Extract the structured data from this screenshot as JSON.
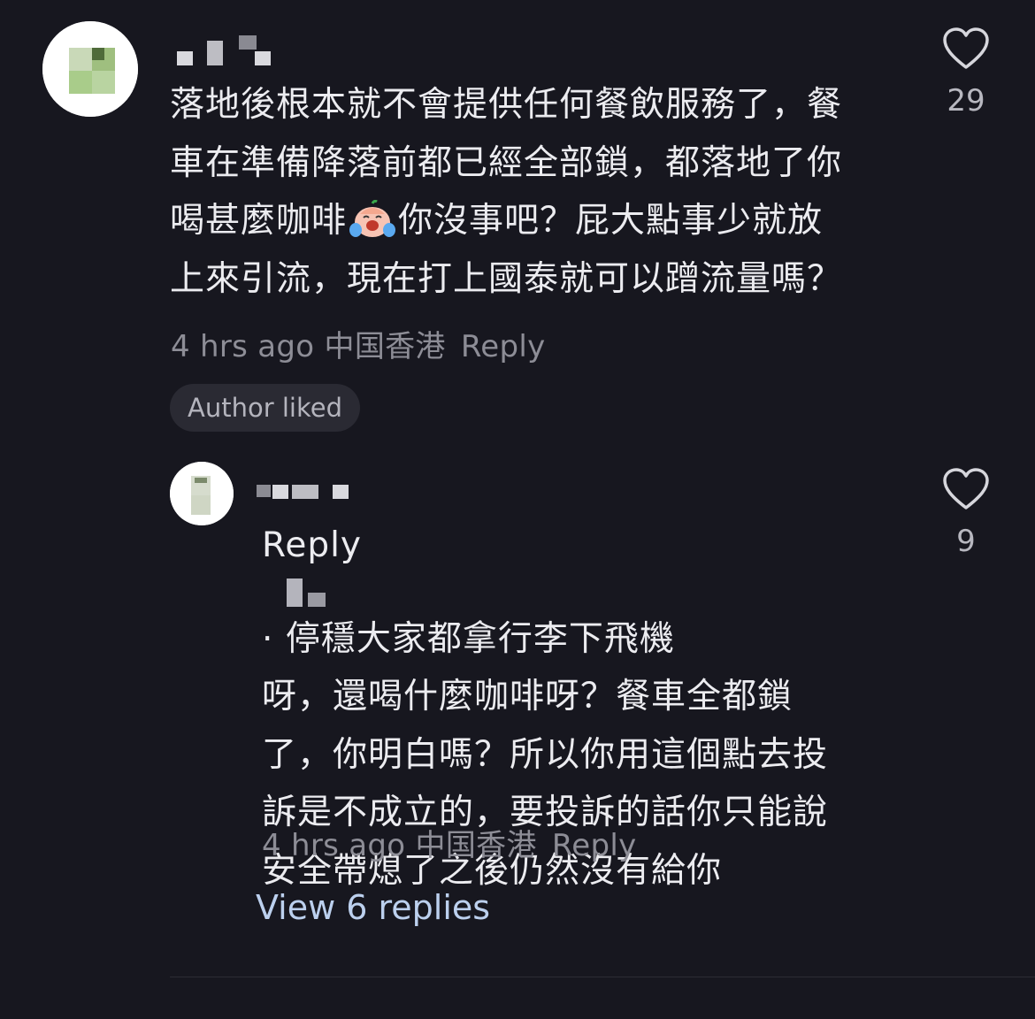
{
  "comment": {
    "text_lines": [
      "落地後根本就不會提供任何餐飲服務了，餐",
      "車在準備降落前都已經全部鎖，都落地了你",
      "喝甚麼咖啡",
      "你沒事吧？屁大點事少就放",
      "上來引流，現在打上國泰就可以蹭流量嗎？"
    ],
    "emoji_icon": "crying-face-emoji",
    "time": "4 hrs ago",
    "location": "中国香港",
    "reply_label": "Reply",
    "like_count": "29",
    "badge": "Author liked"
  },
  "reply": {
    "prefix": "Reply",
    "separator": "·",
    "text_lines": [
      "停穩大家都拿行李下飛機",
      "呀，還喝什麼咖啡呀？餐車全都鎖",
      "了，你明白嗎？所以你用這個點去投",
      "訴是不成立的，要投訴的話你只能說",
      "安全帶熄了之後仍然沒有給你"
    ],
    "time": "4 hrs ago",
    "location": "中国香港",
    "reply_label": "Reply",
    "like_count": "9"
  },
  "view_replies": "View 6 replies",
  "colors": {
    "background": "#17171f",
    "text": "#ececf0",
    "meta": "#8d8d96",
    "link": "#bcd0ee"
  }
}
